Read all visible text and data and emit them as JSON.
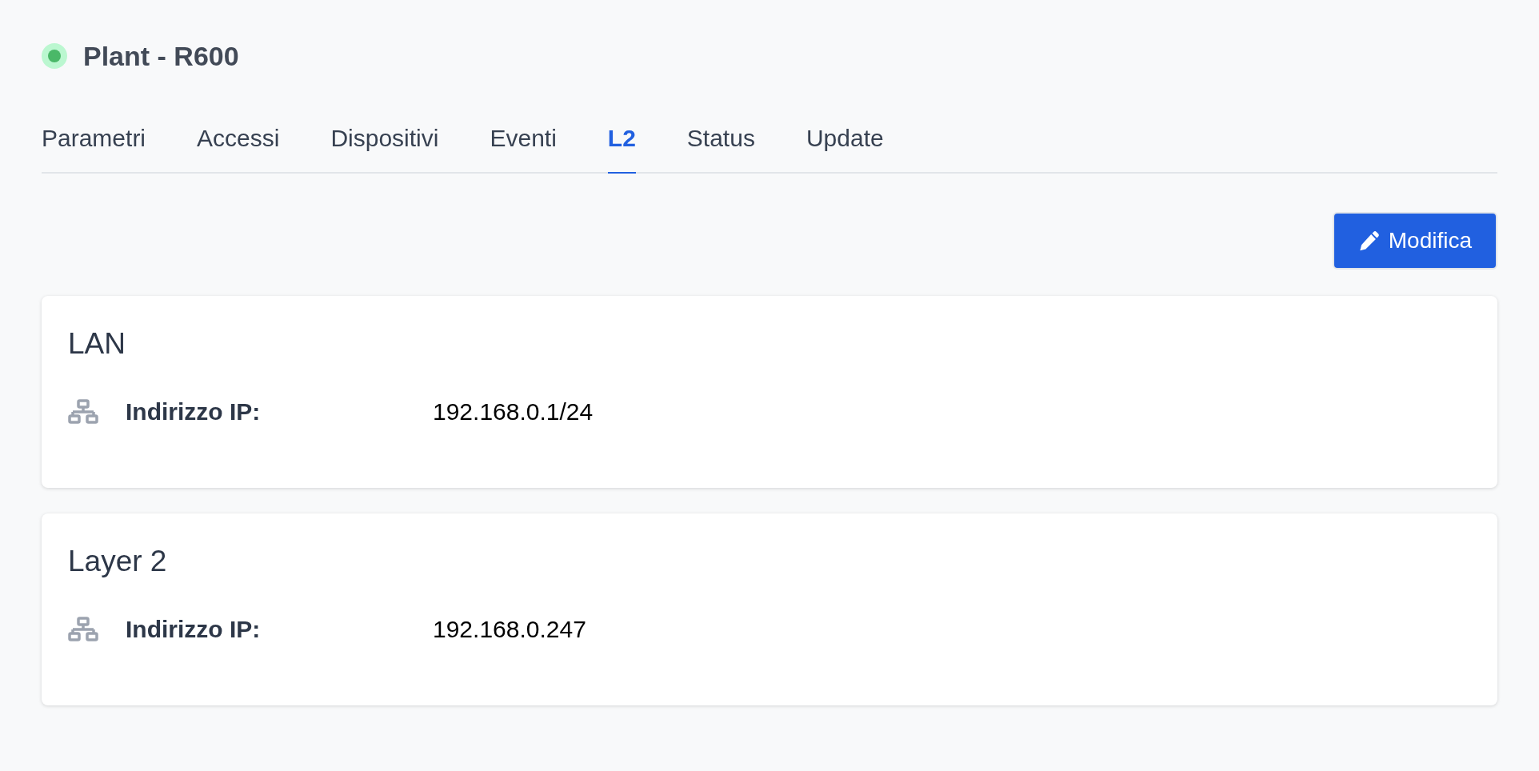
{
  "header": {
    "title": "Plant - R600",
    "online": true
  },
  "tabs": [
    {
      "label": "Parametri",
      "selected": false
    },
    {
      "label": "Accessi",
      "selected": false
    },
    {
      "label": "Dispositivi",
      "selected": false
    },
    {
      "label": "Eventi",
      "selected": false
    },
    {
      "label": "L2",
      "selected": true
    },
    {
      "label": "Status",
      "selected": false
    },
    {
      "label": "Update",
      "selected": false
    }
  ],
  "edit_button": {
    "label": "Modifica"
  },
  "cards": [
    {
      "title": "LAN",
      "rows": [
        {
          "label": "Indirizzo IP:",
          "value": "192.168.0.1/24"
        }
      ]
    },
    {
      "title": "Layer 2",
      "rows": [
        {
          "label": "Indirizzo IP:",
          "value": "192.168.0.247"
        }
      ]
    }
  ]
}
